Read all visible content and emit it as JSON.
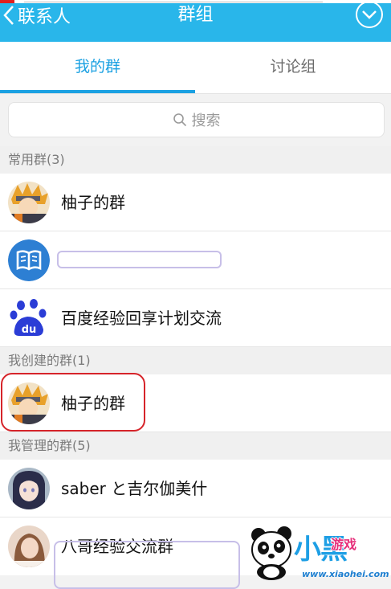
{
  "header": {
    "back_label": "联系人",
    "title": "群组",
    "back_icon": "chevron-left-icon",
    "more_icon": "chevron-down-circle-icon"
  },
  "tabs": [
    {
      "label": "我的群",
      "active": true
    },
    {
      "label": "讨论组",
      "active": false
    }
  ],
  "search": {
    "placeholder": "搜索",
    "icon": "search-icon"
  },
  "sections": {
    "frequent": "常用群(3)",
    "created": "我创建的群(1)",
    "managed": "我管理的群(5)"
  },
  "groups": {
    "frequent": [
      {
        "name": "柚子的群",
        "avatar": "anime-avatar"
      },
      {
        "name": "",
        "avatar": "book-icon"
      },
      {
        "name": "百度经验回享计划交流",
        "avatar": "baidu-paw-icon"
      }
    ],
    "created": [
      {
        "name": "柚子的群",
        "avatar": "anime-avatar"
      }
    ],
    "managed": [
      {
        "name": "saber と吉尔伽美什",
        "avatar": "anime-girl-avatar"
      },
      {
        "name": "八哥经验交流群",
        "avatar": "photo-avatar"
      }
    ]
  },
  "colors": {
    "header_bg": "#29b6ea",
    "accent": "#1ba1e2",
    "annotation_red": "#d6242a"
  },
  "watermark": {
    "brand": "小黑",
    "sub": "游戏",
    "url": "www.xiaohei.com"
  }
}
